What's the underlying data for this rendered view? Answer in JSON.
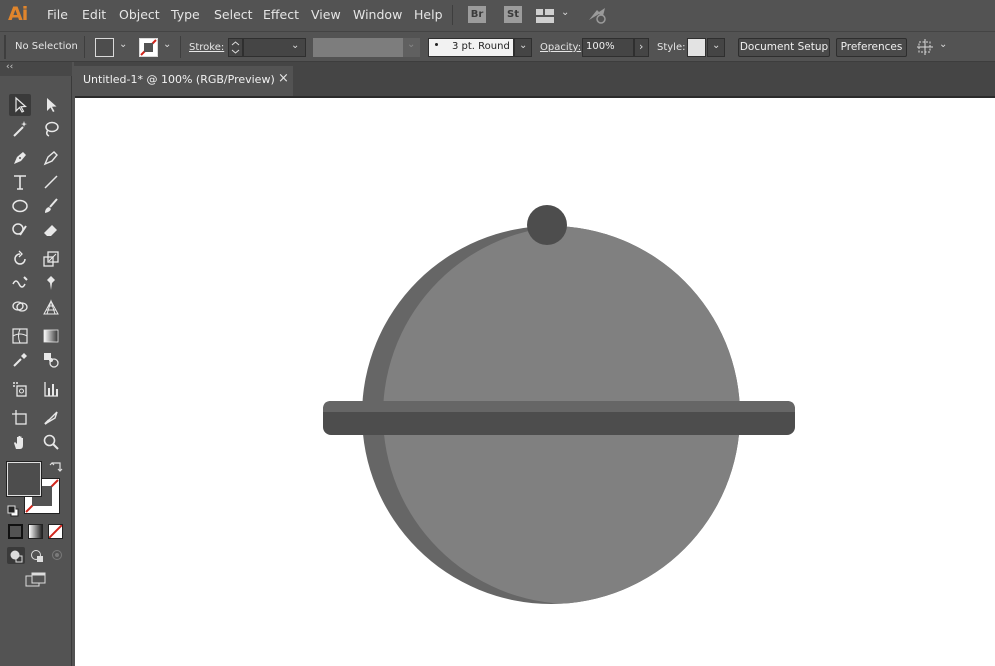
{
  "app": {
    "logo": "Ai"
  },
  "menu": [
    "File",
    "Edit",
    "Object",
    "Type",
    "Select",
    "Effect",
    "View",
    "Window",
    "Help"
  ],
  "appswitch": {
    "bridge": "Br",
    "stock": "St"
  },
  "control": {
    "selection": "No Selection",
    "stroke_label": "Stroke:",
    "brush_value": "3 pt. Round",
    "opacity_label": "Opacity:",
    "opacity_value": "100%",
    "style_label": "Style:",
    "document_setup": "Document Setup",
    "preferences": "Preferences"
  },
  "tabs": [
    {
      "title": "Untitled-1* @ 100% (RGB/Preview)",
      "close": "×"
    }
  ],
  "panel": {
    "collapse": "‹‹"
  },
  "colors": {
    "ui_bg": "#535353",
    "canvas": "#ffffff",
    "dome_main": "#808080",
    "dome_shadow": "#666666",
    "knob": "#4d4d4d",
    "band_top": "#666666",
    "band_bottom": "#4d4d4d",
    "fill_swatch": "#4d4d4d"
  }
}
